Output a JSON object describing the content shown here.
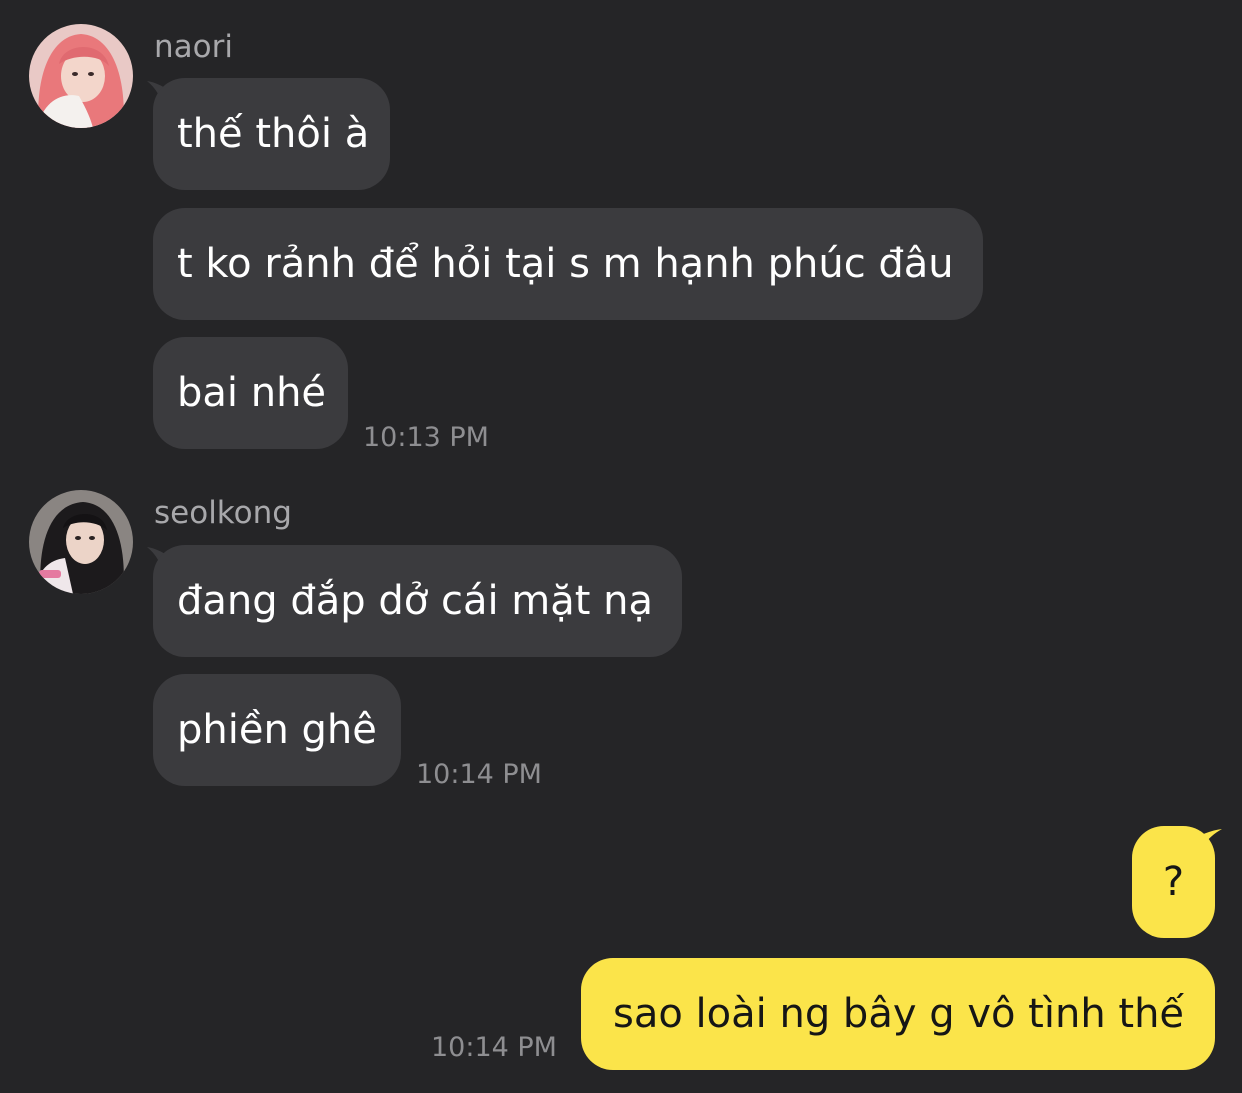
{
  "conversation": {
    "groups": [
      {
        "sender": "naori",
        "messages": [
          "thế thôi à",
          "t ko rảnh để hỏi tại s m hạnh phúc đâu",
          "bai nhé"
        ],
        "time": "10:13 PM"
      },
      {
        "sender": "seolkong",
        "messages": [
          "đang đắp dở cái mặt nạ",
          "phiền ghê"
        ],
        "time": "10:14 PM"
      }
    ],
    "outgoing": {
      "messages": [
        "?",
        "sao loài ng bây g vô tình thế"
      ],
      "time": "10:14 PM"
    }
  },
  "colors": {
    "background": "#252527",
    "incoming_bubble": "#3b3b3e",
    "outgoing_bubble": "#fbe44a",
    "incoming_text": "#ffffff",
    "outgoing_text": "#161616",
    "meta_text": "#8e8e91"
  }
}
